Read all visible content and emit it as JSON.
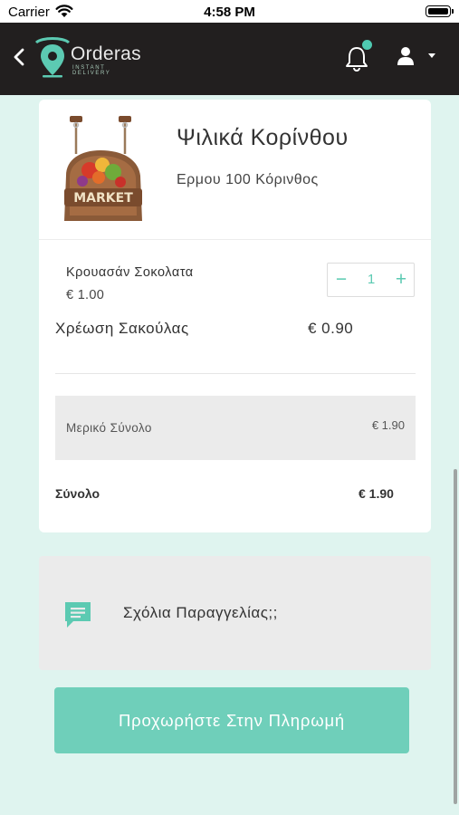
{
  "status_bar": {
    "carrier": "Carrier",
    "time": "4:58 PM"
  },
  "header": {
    "logo_text": "Orderas",
    "logo_tagline": "INSTANT DELIVERY",
    "back_icon": "chevron-left-icon",
    "notification_icon": "bell-icon",
    "user_icon": "user-icon",
    "accent_color": "#4fc9b1"
  },
  "shop": {
    "name": "Ψιλικά Κορίνθου",
    "address": "Ερμου 100 Κόρινθος",
    "sign_text": "MARKET"
  },
  "cart": {
    "items": [
      {
        "name": "Κρουασάν Σοκολατα",
        "price": "€ 1.00",
        "quantity": "1"
      }
    ],
    "bag_fee_label": "Χρέωση Σακούλας",
    "bag_fee_value": "€ 0.90",
    "subtotal_label": "Μερικό Σύνολο",
    "subtotal_value": "€ 1.90",
    "total_label": "Σύνολο",
    "total_value": "€ 1.90"
  },
  "comments": {
    "label": "Σχόλια Παραγγελίας;;",
    "icon": "message-icon"
  },
  "checkout": {
    "label": "Προχωρήστε Στην Πληρωμή",
    "color": "#6fcfba"
  },
  "colors": {
    "background": "#dff4ef",
    "header": "#221f1f",
    "accent": "#5ccab2"
  }
}
